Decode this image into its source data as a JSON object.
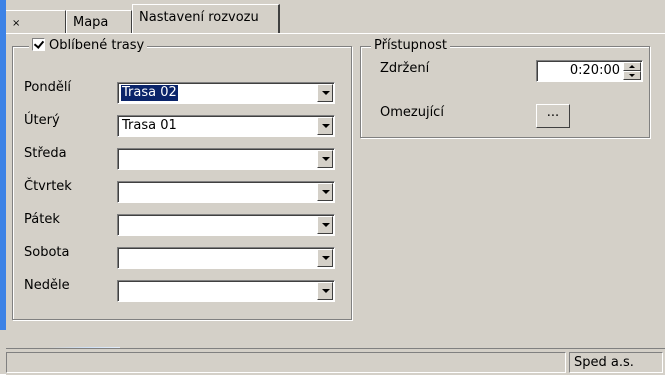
{
  "tabs": [
    {
      "label": "×"
    },
    {
      "label": "Mapa"
    },
    {
      "label": "Nastavení rozvozu",
      "active": true
    }
  ],
  "favorite_routes": {
    "checkbox_label": "Oblíbené trasy",
    "checked": true,
    "days": [
      {
        "label": "Pondělí",
        "value": "Trasa 02",
        "selected": true
      },
      {
        "label": "Úterý",
        "value": "Trasa 01"
      },
      {
        "label": "Středa",
        "value": ""
      },
      {
        "label": "Čtvrtek",
        "value": ""
      },
      {
        "label": "Pátek",
        "value": ""
      },
      {
        "label": "Sobota",
        "value": ""
      },
      {
        "label": "Neděle",
        "value": ""
      }
    ]
  },
  "accessibility": {
    "title": "Přístupnost",
    "delay_label": "Zdržení",
    "delay_value": "0:20:00",
    "restricting_label": "Omezující",
    "restricting_button": "..."
  },
  "statusbar": {
    "company": "Sped a.s."
  },
  "colors": {
    "face": "#d4d0c8",
    "selection": "#0a246a",
    "accent": "#3c82e6"
  }
}
